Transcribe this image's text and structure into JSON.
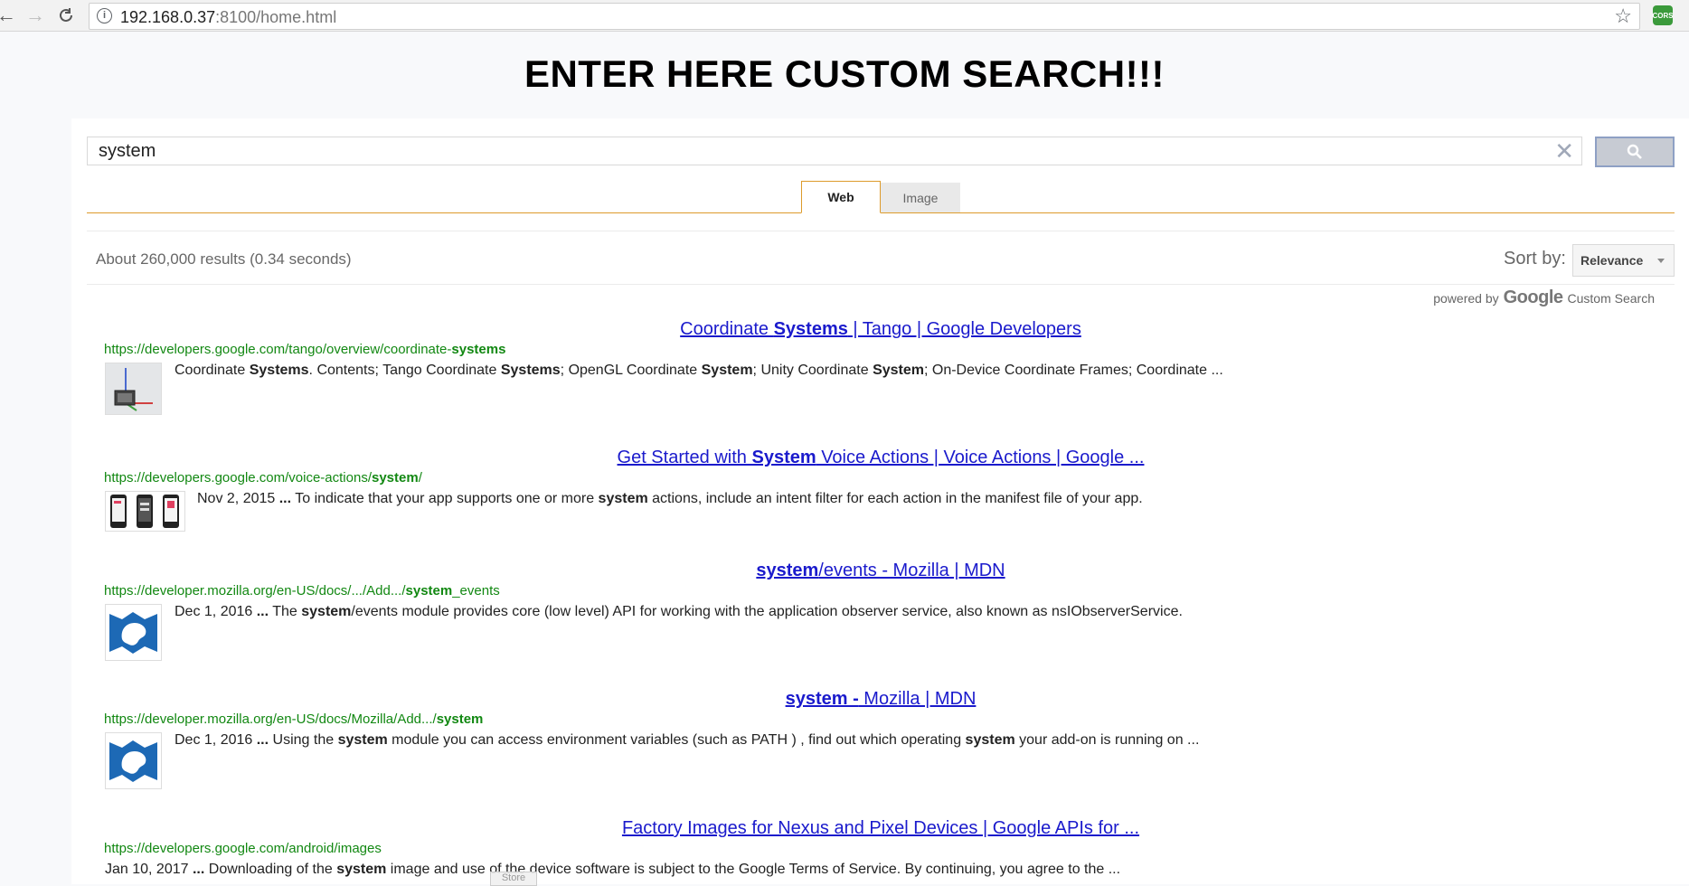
{
  "browser": {
    "url_host": "192.168.0.37",
    "url_path": ":8100/home.html",
    "extension_label": "CORS"
  },
  "page": {
    "title": "ENTER HERE CUSTOM SEARCH!!!"
  },
  "search": {
    "value": "system",
    "placeholder": ""
  },
  "tabs": [
    {
      "label": "Web",
      "active": true
    },
    {
      "label": "Image",
      "active": false
    }
  ],
  "results_info": {
    "count_text": "About 260,000 results (0.34 seconds)",
    "sort_label": "Sort by:",
    "sort_value": "Relevance"
  },
  "branding": {
    "powered_by": "powered by",
    "google": "Google",
    "custom_search": "Custom Search"
  },
  "results": [
    {
      "title_pre": "Coordinate ",
      "title_bold": "Systems",
      "title_post": " | Tango | Google Developers",
      "url_pre": "https://developers.google.com/tango/overview/coordinate-",
      "url_bold": "systems",
      "url_post": "",
      "thumb": "axes-thumbnail",
      "snippet": [
        {
          "t": "Coordinate "
        },
        {
          "b": "Systems"
        },
        {
          "t": ". Contents; Tango Coordinate "
        },
        {
          "b": "Systems"
        },
        {
          "t": "; OpenGL Coordinate "
        },
        {
          "b": "System"
        },
        {
          "t": "; Unity Coordinate "
        },
        {
          "b": "System"
        },
        {
          "t": "; On-Device Coordinate Frames; Coordinate ..."
        }
      ]
    },
    {
      "title_pre": "Get Started with ",
      "title_bold": "System",
      "title_post": " Voice Actions | Voice Actions | Google ...",
      "url_pre": "https://developers.google.com/voice-actions/",
      "url_bold": "system",
      "url_post": "/",
      "thumb": "phones-thumbnail",
      "snippet": [
        {
          "t": "Nov 2, 2015 "
        },
        {
          "b": "..."
        },
        {
          "t": " To indicate that your app supports one or more "
        },
        {
          "b": "system"
        },
        {
          "t": " actions, include an intent filter for each action in the manifest file of your app."
        }
      ]
    },
    {
      "title_pre": "",
      "title_bold": "system",
      "title_post": "/events - Mozilla | MDN",
      "url_pre": "https://developer.mozilla.org/en-US/docs/.../Add.../",
      "url_bold": "system",
      "url_post": "_events",
      "thumb": "mdn-thumbnail",
      "snippet": [
        {
          "t": "Dec 1, 2016 "
        },
        {
          "b": "..."
        },
        {
          "t": " The "
        },
        {
          "b": "system"
        },
        {
          "t": "/events module provides core (low level) API for working with the application observer service, also known as nsIObserverService."
        }
      ]
    },
    {
      "title_pre": "",
      "title_bold": "system -",
      "title_post": " Mozilla | MDN",
      "url_pre": "https://developer.mozilla.org/en-US/docs/Mozilla/Add.../",
      "url_bold": "system",
      "url_post": "",
      "thumb": "mdn-thumbnail",
      "snippet": [
        {
          "t": "Dec 1, 2016 "
        },
        {
          "b": "..."
        },
        {
          "t": " Using the "
        },
        {
          "b": "system"
        },
        {
          "t": " module you can access environment variables (such as PATH ) , find out which operating "
        },
        {
          "b": "system"
        },
        {
          "t": " your add-on is running on ..."
        }
      ]
    },
    {
      "title_pre": "Factory Images for Nexus and Pixel Devices | Google APIs for ...",
      "title_bold": "",
      "title_post": "",
      "url_pre": "https://developers.google.com/android/images",
      "url_bold": "",
      "url_post": "",
      "thumb": "",
      "snippet": [
        {
          "t": "Jan 10, 2017 "
        },
        {
          "b": "..."
        },
        {
          "t": " Downloading of the "
        },
        {
          "b": "system"
        },
        {
          "t": " image and use of the device software is subject to the Google Terms of Service. By continuing, you agree to the ..."
        }
      ]
    }
  ],
  "overlay": {
    "label": "Store"
  }
}
